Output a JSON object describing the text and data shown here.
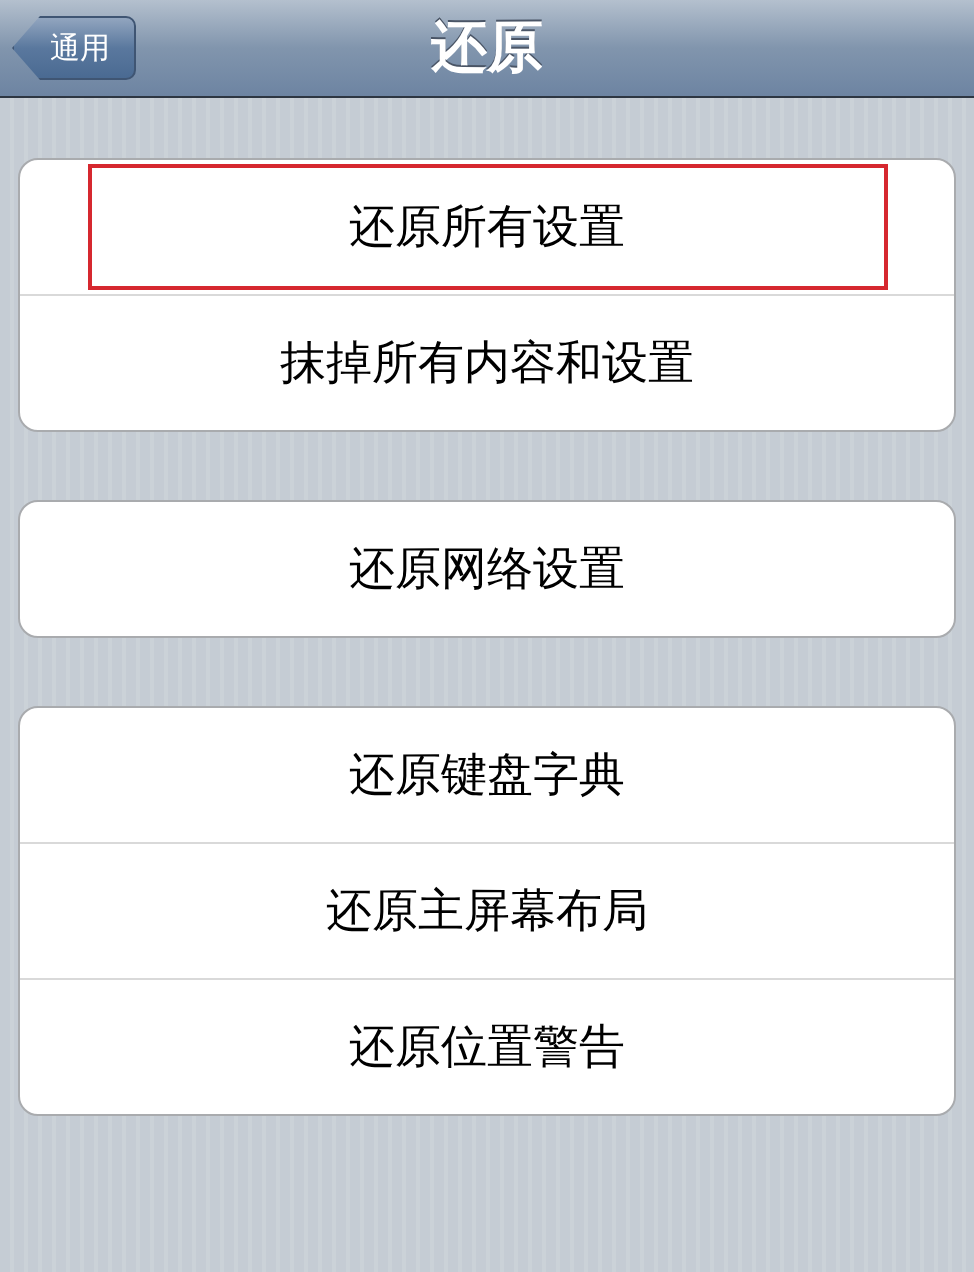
{
  "nav_bar": {
    "back_button": "通用",
    "title": "还原"
  },
  "groups": [
    {
      "items": [
        {
          "label": "还原所有设置",
          "highlighted": true
        },
        {
          "label": "抹掉所有内容和设置",
          "highlighted": false
        }
      ]
    },
    {
      "items": [
        {
          "label": "还原网络设置",
          "highlighted": false
        }
      ]
    },
    {
      "items": [
        {
          "label": "还原键盘字典",
          "highlighted": false
        },
        {
          "label": "还原主屏幕布局",
          "highlighted": false
        },
        {
          "label": "还原位置警告",
          "highlighted": false
        }
      ]
    }
  ]
}
